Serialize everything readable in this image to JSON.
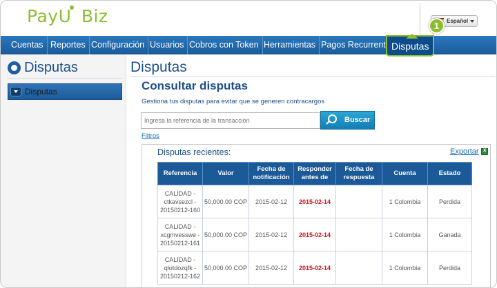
{
  "header": {
    "logo_text": "PayU",
    "logo_suffix": "Biz",
    "language": "Español"
  },
  "nav": {
    "items": [
      "Cuentas",
      "Reportes",
      "Configuración",
      "Usuarios",
      "Cobros con Token",
      "Herramientas",
      "Pagos Recurrente",
      "Disputas"
    ],
    "active": "Disputas",
    "step_badge": "1"
  },
  "sidebar": {
    "title": "Disputas",
    "items": [
      {
        "label": "Disputas"
      }
    ]
  },
  "main": {
    "title": "Disputas",
    "subtitle": "Consultar disputas",
    "description": "Gestiona tus disputas para evitar que se generen contracargos",
    "search_placeholder": "Ingresa la referencia de la transacción",
    "search_button": "Buscar",
    "filters_link": "Filtros",
    "recent_title": "Disputas recientes:",
    "export_link": "Exportar"
  },
  "table": {
    "headers": [
      "Referencia",
      "Valor",
      "Fecha de notificación",
      "Responder antes de",
      "Fecha de respuesta",
      "Cuenta",
      "Estado"
    ],
    "rows": [
      {
        "reference": "CALIDAD - ctkavsezcl - 20150212-160",
        "value": "50,000.00 COP",
        "notification_date": "2015-02-12",
        "respond_before": "2015-02-14",
        "response_date": "",
        "account": "1 Colombia",
        "status": "Perdida"
      },
      {
        "reference": "CALIDAD - xcgmvesswe - 20150212-161",
        "value": "50,000.00 COP",
        "notification_date": "2015-02-12",
        "respond_before": "2015-02-14",
        "response_date": "",
        "account": "1 Colombia",
        "status": "Ganada"
      },
      {
        "reference": "CALIDAD - qlotdozqfk - 20150212-162",
        "value": "50,000.00 COP",
        "notification_date": "2015-02-12",
        "respond_before": "2015-02-14",
        "response_date": "",
        "account": "1 Colombia",
        "status": "Perdida"
      }
    ]
  },
  "colors": {
    "brand_green": "#8cbf2f",
    "nav_blue": "#1b5c9b",
    "title_blue": "#1d4e8a",
    "deadline_red": "#d0101c"
  }
}
